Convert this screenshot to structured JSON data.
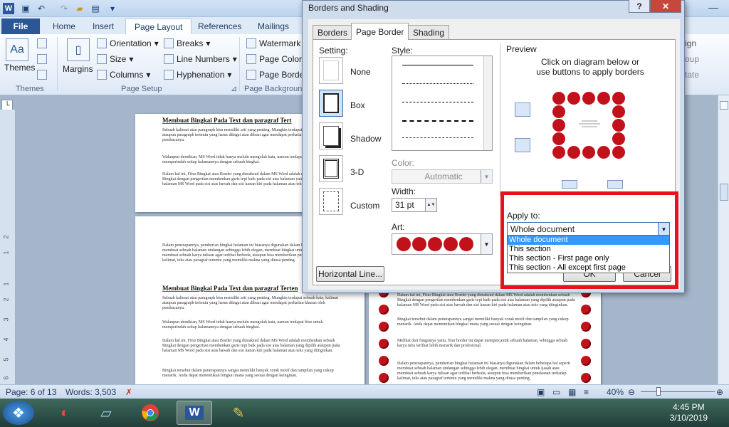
{
  "titlebar": {
    "quick_access_icons": [
      "word-icon",
      "save-icon",
      "undo-icon",
      "redo-icon",
      "open-icon",
      "print-icon",
      "customize-icon"
    ],
    "window_help": "?",
    "window_close": "✕"
  },
  "ribbon_tabs": [
    "File",
    "Home",
    "Insert",
    "Page Layout",
    "Mailings"
  ],
  "ribbon_tabs_partial": [
    "References"
  ],
  "ribbon": {
    "themes_label": "Themes",
    "themes_group": "Themes",
    "margins_label": "Margins",
    "orientation": "Orientation",
    "size": "Size",
    "columns": "Columns",
    "breaks": "Breaks",
    "line_numbers": "Line Numbers",
    "hyphenation": "Hyphenation",
    "page_setup_group": "Page Setup",
    "watermark": "Watermark",
    "page_color": "Page Color",
    "page_borders": "Page Borde",
    "page_background_group": "Page Backgroun",
    "right_partial": [
      "ign",
      "oup",
      "tate"
    ]
  },
  "document": {
    "heading": "Membuat Bingkai Pada Text dan paragraf Tert",
    "heading2": "Membuat Bingkai Pada Text dan paragraf Terten",
    "para1": "Sebuah kalimat atau paragraph bisa memiliki arti yang penting. Mungkin terdapat sebuah kata, kalimat ataupun paragraph tertentu yang harus diingat atau dibuat agar mendapat perhatian khusus oleh pembacanya.",
    "para2": "Walaupun demikian, MS Word tidak hanya melulu mengolah kata, namun terdapat fitur untuk memperindah setiap halamannya dengan sebuah bingkai.",
    "para3": "Dalam hal ini, Fitur Bingkai atau Border yang dimaksud dalam MS Word adalah membenkan sebuah Bingkai dengan pengertian membenkan garis tepi baik pada sisi atas halaman yang dipilih ataupun pada halaman MS Word pada sisi atas bawah dan sisi kanan kiri pada halaman atau teks yang diinginkan.",
    "para4": "Dalam penerapannya, pemberian bingkai halaman ini biasanya digunakan dalam beberapa hal seperti membuat sebuah halaman undangan sehingga lebih elegan, membuat bingkai untuk ijasah atau membuat sebuah karya tulisan agar terlihat berbeda, ataupun bisa memberikan penekanan terhadap kalimat, teks atau paragraf tertentu yang memiliki makna yang dirasa penting.",
    "para5": "Bingkai tersebut dalam penerapannya sangat memiliki banyak corak motif dan tampilan yang cukup menarik. Anda dapat menentukan bingkai mana yang sesuai dengan keinginan.",
    "para6": "Melihat dari fungsinya yaitu, fitur border ini dapat mempercantik sebuah halaman, sehingga sebuah karya tulis terlihat lebih menarik dan profesional."
  },
  "ruler_numbers": [
    "2",
    "1",
    "1",
    "2",
    "3",
    "4",
    "5",
    "6",
    "7",
    "8",
    "9",
    "10",
    "11",
    "12"
  ],
  "statusbar": {
    "page": "Page: 6 of 13",
    "words": "Words: 3,503",
    "zoom": "40%"
  },
  "taskbar": {
    "apps": [
      "start-orb-icon",
      "ccleaner-icon",
      "glass-folder-icon",
      "chrome-icon",
      "word-icon",
      "paint-icon"
    ],
    "time": "4:45 PM",
    "date": "3/10/2019"
  },
  "dialog": {
    "title": "Borders and Shading",
    "help": "?",
    "close": "✕",
    "tabs": [
      "Borders",
      "Page Border",
      "Shading"
    ],
    "active_tab": "Page Border",
    "setting_label": "Setting:",
    "settings": [
      "None",
      "Box",
      "Shadow",
      "3-D",
      "Custom"
    ],
    "selected_setting": "Box",
    "style_label": "Style:",
    "color_label": "Color:",
    "color_value": "Automatic",
    "width_label": "Width:",
    "width_value": "31 pt",
    "art_label": "Art:",
    "preview_label": "Preview",
    "preview_hint": "Click on diagram below or use buttons to apply borders",
    "apply_to_label": "Apply to:",
    "apply_to_value": "Whole document",
    "apply_to_options": [
      "Whole document",
      "This section",
      "This section - First page only",
      "This section - All except first page"
    ],
    "horizontal_line_button": "Horizontal Line...",
    "ok_button": "OK",
    "cancel_button": "Cancel"
  },
  "colors": {
    "highlight_red": "#e8121e",
    "selection_blue": "#3399ff",
    "art_red": "#c1121c",
    "file_tab": "#2b5797"
  }
}
